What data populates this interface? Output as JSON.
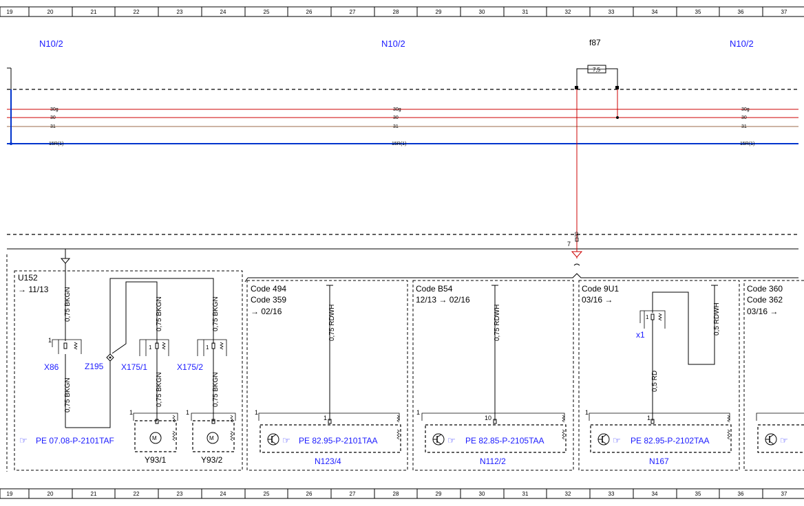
{
  "ruler": {
    "numbers": [
      "19",
      "20",
      "21",
      "22",
      "23",
      "24",
      "25",
      "26",
      "27",
      "28",
      "29",
      "30",
      "31",
      "32",
      "33",
      "34",
      "35",
      "36",
      "37"
    ]
  },
  "headers": {
    "n10_left": "N10/2",
    "n10_mid": "N10/2",
    "n10_right": "N10/2",
    "fuse_name": "f87",
    "fuse_value": "7,5"
  },
  "bus_labels": {
    "left": [
      "30g",
      "30",
      "31",
      "15R(1)"
    ],
    "mid": [
      "30g",
      "30",
      "31",
      "15R(1)"
    ],
    "right": [
      "30g",
      "30",
      "31",
      "15R(1)"
    ]
  },
  "connector": {
    "pin_label": "30",
    "pin_number": "7"
  },
  "u152": {
    "title": "U152",
    "date": "→ 11/13",
    "wire_x86_top": "0,75 BKGN",
    "wire_x86_bottom": "0,75 BKGN",
    "wire_x175_1_top": "0,75 BKGN",
    "wire_x175_1_bottom": "0,75 BKGN",
    "wire_x175_2_top": "0,75 BKGN",
    "wire_x175_2_bottom": "0,75 BKGN",
    "x86": "X86",
    "z195": "Z195",
    "x175_1": "X175/1",
    "x175_2": "X175/2",
    "y93_1": "Y93/1",
    "y93_2": "Y93/2",
    "pe_ref": "PE 07.08-P-2101TAF",
    "pin1": "1"
  },
  "n123": {
    "codes": [
      "Code 494",
      "Code 359"
    ],
    "date": "→ 02/16",
    "wire": "0,75 RDWH",
    "pin": "1",
    "pe_ref": "PE 82.95-P-2101TAA",
    "name": "N123/4",
    "box_pin": "1"
  },
  "n112": {
    "codes": [
      "Code B54"
    ],
    "date": "12/13 → 02/16",
    "wire": "0,75 RDWH",
    "pin": "10",
    "pe_ref": "PE 82.85-P-2105TAA",
    "name": "N112/2",
    "box_pin": "1"
  },
  "n167": {
    "codes": [
      "Code 9U1"
    ],
    "date": "03/16 →",
    "wire_right": "0,5 RDWH",
    "wire_rd": "0,5 RD",
    "x1": "x1",
    "pin": "1",
    "pe_ref": "PE 82.95-P-2102TAA",
    "name": "N167",
    "box_pin": "1"
  },
  "right_box": {
    "codes": [
      "Code 360",
      "Code 362"
    ],
    "date": "03/16 →"
  },
  "colors": {
    "link": "#1a1aff",
    "wire_red": "#cc0000",
    "wire_brown": "#9b6a4a",
    "wire_blue": "#0033cc"
  }
}
